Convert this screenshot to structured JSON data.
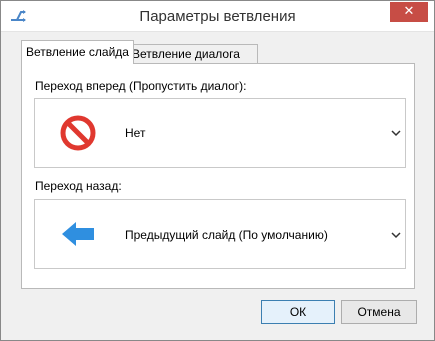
{
  "window": {
    "title": "Параметры ветвления",
    "close_label": "✕"
  },
  "tabs": [
    {
      "label": "Ветвление слайда",
      "active": true
    },
    {
      "label": "Ветвление диалога",
      "active": false
    }
  ],
  "forward": {
    "label": "Переход вперед (Пропустить диалог):",
    "value": "Нет",
    "icon": "no-entry-icon"
  },
  "back": {
    "label": "Переход назад:",
    "value": "Предыдущий слайд (По умолчанию)",
    "icon": "blue-left-arrow-icon"
  },
  "buttons": {
    "ok": "ОК",
    "cancel": "Отмена"
  },
  "colors": {
    "close": "#c74d45",
    "no_entry": "#e0382f",
    "arrow": "#2f8fe0"
  }
}
